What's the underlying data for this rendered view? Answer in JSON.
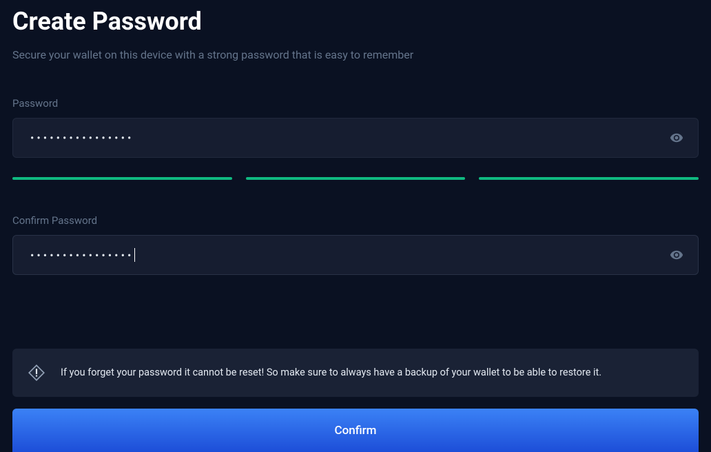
{
  "header": {
    "title": "Create Password",
    "subtitle": "Secure your wallet on this device with a strong password that is easy to remember"
  },
  "form": {
    "password": {
      "label": "Password",
      "value": "••••••••••••••••",
      "eye_icon": "eye-icon"
    },
    "strength": {
      "bars": 3,
      "filled": 3,
      "color": "#10b981"
    },
    "confirm": {
      "label": "Confirm Password",
      "value": "••••••••••••••••",
      "eye_icon": "eye-icon",
      "has_cursor": true
    }
  },
  "warning": {
    "icon": "alert-diamond-icon",
    "text": "If you forget your password it cannot be reset! So make sure to always have a backup of your wallet to be able to restore it."
  },
  "actions": {
    "confirm_label": "Confirm"
  }
}
